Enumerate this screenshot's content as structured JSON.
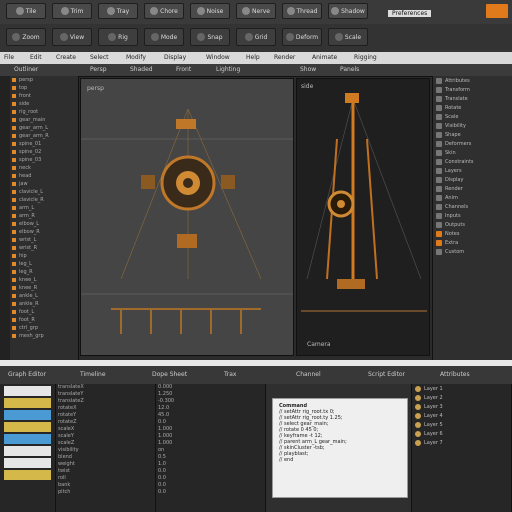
{
  "colors": {
    "accent": "#e07a1a",
    "bg": "#2b2b2b",
    "panel": "#3a3a3a"
  },
  "toolbar": {
    "row1_labels": [
      "Tile",
      "Trim",
      "Tray",
      "Chore",
      "Noise",
      "Nerve",
      "Thread",
      "Shadow"
    ],
    "row2_labels": [
      "Zoom",
      "View",
      "Rig",
      "Mode",
      "Snap",
      "Grid",
      "Deform",
      "Scale"
    ],
    "right_label": "Preferences"
  },
  "menu": {
    "items": [
      "File",
      "Edit",
      "Create",
      "Select",
      "Modify",
      "Display",
      "Window",
      "Help",
      "Render",
      "Animate",
      "Rigging"
    ]
  },
  "subbar": {
    "items": [
      "Outliner",
      "Persp",
      "Shaded",
      "Front",
      "Lighting",
      "Show",
      "Panels"
    ]
  },
  "outliner": {
    "rows": [
      "persp",
      "top",
      "front",
      "side",
      "rig_root",
      "gear_main",
      "gear_arm_L",
      "gear_arm_R",
      "spine_01",
      "spine_02",
      "spine_03",
      "neck",
      "head",
      "jaw",
      "clavicle_L",
      "clavicle_R",
      "arm_L",
      "arm_R",
      "elbow_L",
      "elbow_R",
      "wrist_L",
      "wrist_R",
      "hip",
      "leg_L",
      "leg_R",
      "knee_L",
      "knee_R",
      "ankle_L",
      "ankle_R",
      "foot_L",
      "foot_R",
      "ctrl_grp",
      "mesh_grp"
    ]
  },
  "viewport_left": {
    "label": "persp"
  },
  "viewport_right": {
    "label": "side",
    "footer": "Camera"
  },
  "right_panel": {
    "rows": [
      "Attributes",
      "Transform",
      "Translate",
      "Rotate",
      "Scale",
      "Visibility",
      "Shape",
      "Deformers",
      "Skin",
      "Constraints",
      "Layers",
      "Display",
      "Render",
      "Anim",
      "Channels",
      "Inputs",
      "Outputs",
      "Notes",
      "Extra",
      "Custom"
    ]
  },
  "bottom": {
    "tabs": [
      "Graph Editor",
      "Timeline",
      "Dope Sheet",
      "Trax",
      "Channel",
      "Script Editor",
      "Attributes"
    ],
    "list_rows": [
      "translateX",
      "translateY",
      "translateZ",
      "rotateX",
      "rotateY",
      "rotateZ",
      "scaleX",
      "scaleY",
      "scaleZ",
      "visibility",
      "blend",
      "weight",
      "twist",
      "roll",
      "bank",
      "pitch"
    ],
    "values": [
      "0.000",
      "1.250",
      "-0.300",
      "12.0",
      "45.0",
      "0.0",
      "1.000",
      "1.000",
      "1.000",
      "on",
      "0.5",
      "1.0",
      "0.0",
      "0.0",
      "0.0",
      "0.0"
    ],
    "doc_lines": [
      "Command",
      "// setAttr rig_root.tx 0;",
      "// setAttr rig_root.ty 1.25;",
      "// select gear_main;",
      "// rotate 0 45 0;",
      "// keyframe -t 12;",
      "// parent arm_L gear_main;",
      "// skinCluster -tsb;",
      "// playblast;",
      "// end"
    ],
    "right_rows": [
      "Layer 1",
      "Layer 2",
      "Layer 3",
      "Layer 4",
      "Layer 5",
      "Layer 6",
      "Layer 7"
    ]
  }
}
